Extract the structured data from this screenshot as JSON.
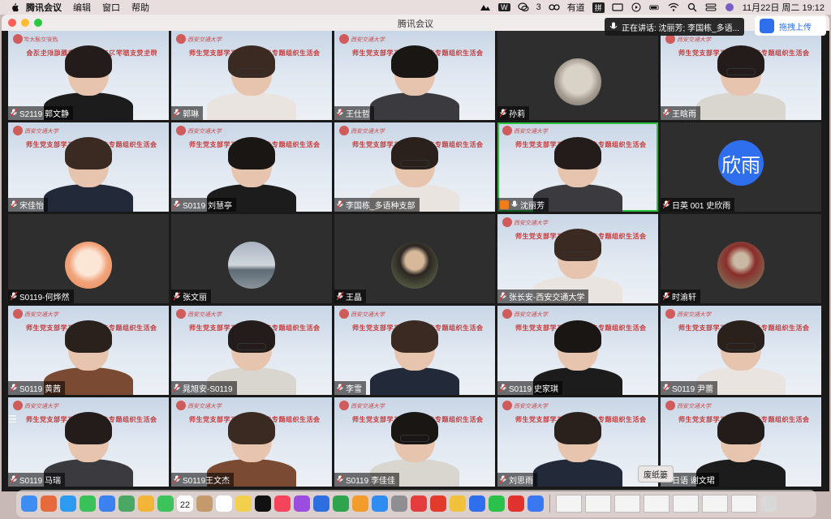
{
  "menubar": {
    "app_name": "腾讯会议",
    "menus": [
      "编辑",
      "窗口",
      "帮助"
    ],
    "notif_count": "3",
    "youdao": "有道",
    "ime": "拼",
    "datetime": "11月22日 周二  19:12"
  },
  "window": {
    "title": "腾讯会议"
  },
  "speaking": {
    "text": "正在讲话: 沈丽芳; 李国栋_多语..."
  },
  "upload": {
    "label": "拖拽上传"
  },
  "banner_text": "师生党支部学习二十大报告专题组织生活会",
  "university_text": "西安交通大学",
  "participants": [
    {
      "name": "S2119 郭文静",
      "kind": "video",
      "mirrored": true
    },
    {
      "name": "郭琳",
      "kind": "video"
    },
    {
      "name": "王仕哲",
      "kind": "video"
    },
    {
      "name": "孙莉",
      "kind": "avatar-cat"
    },
    {
      "name": "王晗雨",
      "kind": "video"
    },
    {
      "name": "宋佳怡",
      "kind": "video"
    },
    {
      "name": "S0119 刘慧亭",
      "kind": "video"
    },
    {
      "name": "李国栋_多语种支部",
      "kind": "video"
    },
    {
      "name": "沈丽芳",
      "kind": "video",
      "active": true,
      "host": true
    },
    {
      "name": "日英 001 史欣雨",
      "kind": "avatar-text",
      "avatar_text": "欣雨"
    },
    {
      "name": "S0119-何烨然",
      "kind": "avatar-cartoon"
    },
    {
      "name": "张文丽",
      "kind": "avatar-sea"
    },
    {
      "name": "王晶",
      "kind": "avatar-photo"
    },
    {
      "name": "张长安-西安交通大学",
      "kind": "video"
    },
    {
      "name": "时渝轩",
      "kind": "avatar-figure"
    },
    {
      "name": "S0119 黄茜",
      "kind": "video"
    },
    {
      "name": "晁旭安-S0119",
      "kind": "video"
    },
    {
      "name": "李雪",
      "kind": "video"
    },
    {
      "name": "S0119 史家琪",
      "kind": "video"
    },
    {
      "name": "S0119 尹蕾",
      "kind": "video"
    },
    {
      "name": "S0119 马瑞",
      "kind": "video"
    },
    {
      "name": "S0119王文杰",
      "kind": "video"
    },
    {
      "name": "S0119 李佳佳",
      "kind": "video"
    },
    {
      "name": "刘思雨",
      "kind": "video"
    },
    {
      "name": "日语 谢文珺",
      "kind": "video"
    }
  ],
  "tooltip": "废纸篓",
  "dock": {
    "calendar_month": "11月",
    "calendar_day": "22",
    "apps": [
      "finder-icon",
      "launchpad-icon",
      "safari-icon",
      "messages-icon",
      "mail-icon",
      "maps-icon",
      "photos-icon",
      "facetime-icon",
      "calendar-icon",
      "contacts-icon",
      "reminders-icon",
      "notes-icon",
      "appletv-icon",
      "music-icon",
      "podcasts-icon",
      "keynote-icon",
      "numbers-icon",
      "pages-icon",
      "appstore-icon",
      "settings-icon",
      "youdao-icon",
      "wps-icon",
      "chrome-icon",
      "tencent-meeting-icon",
      "wechat-icon",
      "netease-music-icon",
      "feishu-icon"
    ]
  }
}
